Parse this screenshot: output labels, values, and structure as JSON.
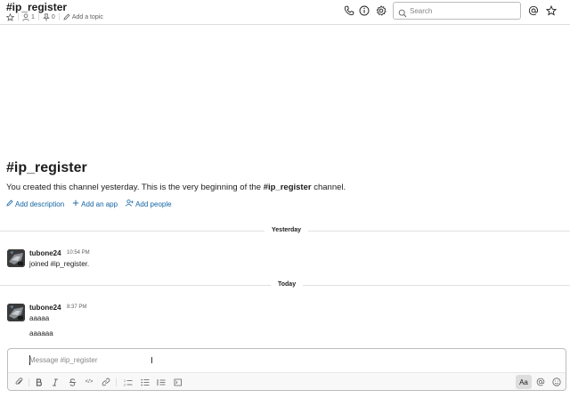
{
  "header": {
    "channel_title": "#ip_register",
    "member_count": "1",
    "pinned_count": "0",
    "add_topic": "Add a topic",
    "search_placeholder": "Search"
  },
  "intro": {
    "title": "#ip_register",
    "desc_prefix": "You created this channel yesterday. This is the very beginning of the ",
    "desc_channel": "#ip_register",
    "desc_suffix": " channel.",
    "links": [
      "Add description",
      "Add an app",
      "Add people"
    ]
  },
  "dividers": {
    "yesterday": "Yesterday",
    "today": "Today"
  },
  "messages": [
    {
      "author": "tubone24",
      "time": "10:54 PM",
      "lines": [
        "joined #ip_register."
      ]
    },
    {
      "author": "tubone24",
      "time": "8:37 PM",
      "lines": [
        "aaaaa",
        "aaaaaa"
      ]
    }
  ],
  "composer": {
    "placeholder": "Message #ip_register",
    "format_label": "Aa",
    "code_label": "</>"
  },
  "colors": {
    "link": "#1264a3",
    "text": "#1d1c1d",
    "muted": "#616061"
  }
}
